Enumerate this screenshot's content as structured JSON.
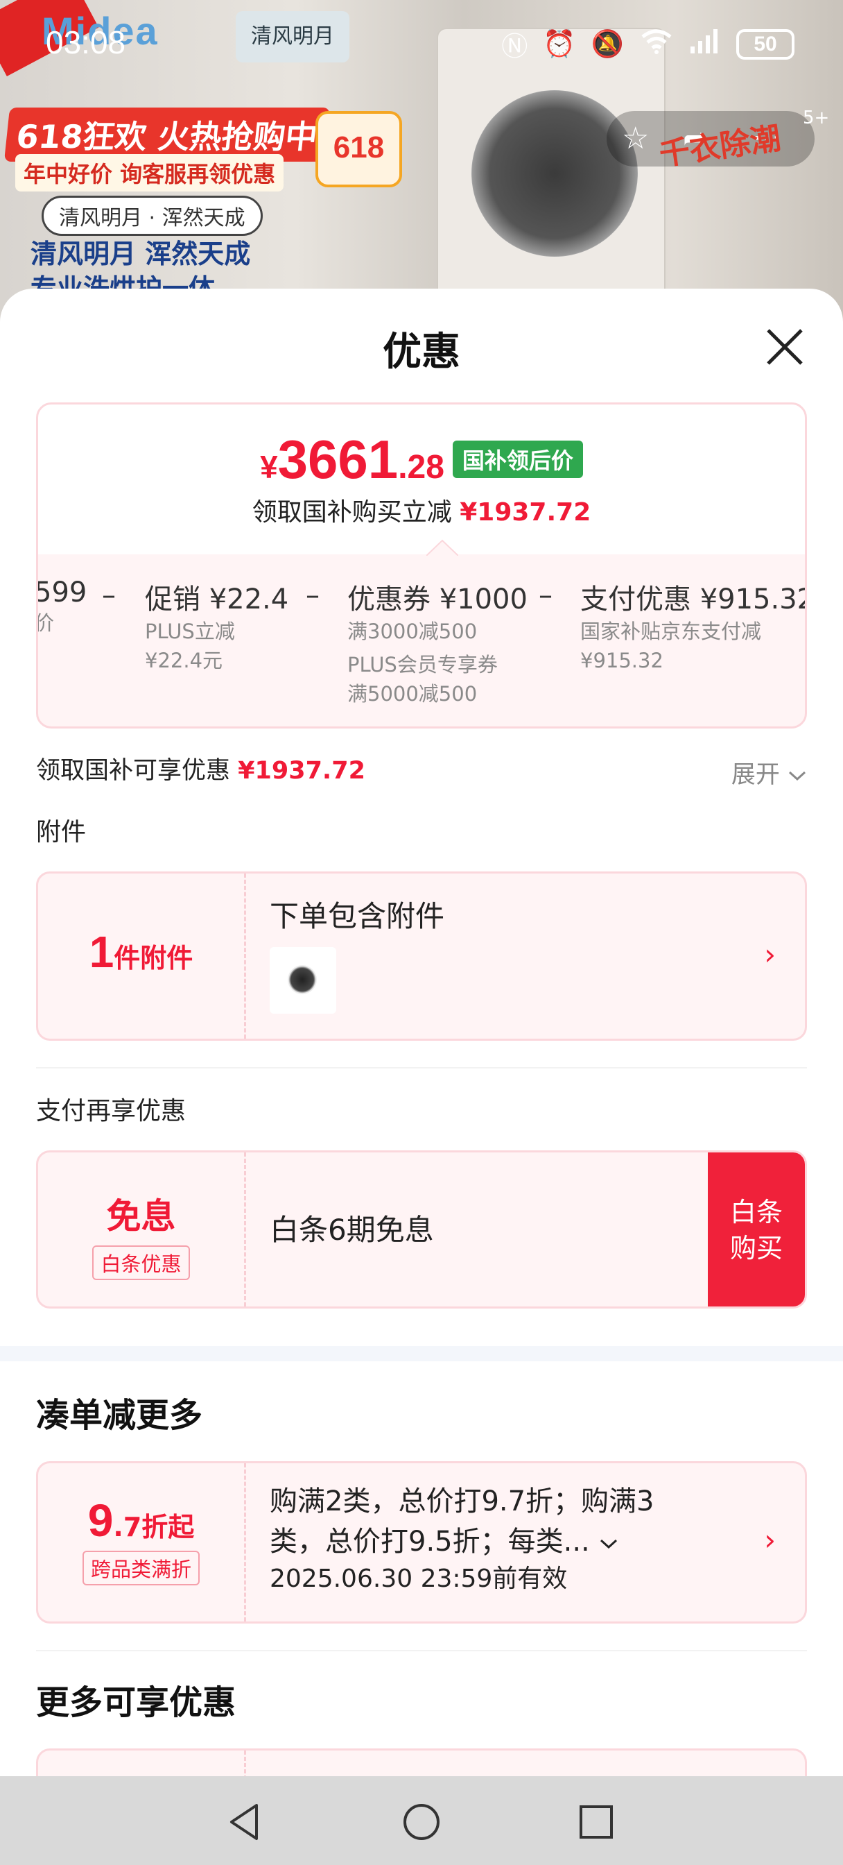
{
  "status_bar": {
    "time": "03:08",
    "battery": "50"
  },
  "background": {
    "brand": "Midea",
    "brand2": "清风明月",
    "promo_title": "618狂欢 火热抢购中",
    "promo_sub": "年中好价 询客服再领优惠",
    "pill": "清风明月 · 浑然天成",
    "slogan": "清风明月 浑然天成",
    "slogan2": "专业洗烘护一体",
    "badge_618": "618",
    "right_text": "千衣除潮",
    "share_count": "5+"
  },
  "sheet": {
    "title": "优惠"
  },
  "price_card": {
    "currency": "¥",
    "price_int": "3661",
    "price_dec": ".28",
    "price_tag": "国补领后价",
    "subtitle_prefix": "领取国补购买立减",
    "subtitle_amount": "¥1937.72",
    "breakdown": [
      {
        "title": "599",
        "desc": [
          "价"
        ]
      },
      {
        "title": "促销 ¥22.4",
        "desc": [
          "PLUS立减",
          "¥22.4元"
        ]
      },
      {
        "title": "优惠券 ¥1000",
        "desc": [
          "满3000减500",
          "PLUS会员专享券",
          "满5000减500"
        ]
      },
      {
        "title": "支付优惠 ¥915.32",
        "desc": [
          "国家补贴京东支付减",
          "¥915.32"
        ]
      }
    ],
    "minus": "–"
  },
  "saving_row": {
    "label": "领取国补可享优惠",
    "amount": "¥1937.72",
    "expand_label": "展开"
  },
  "attachments": {
    "section_label": "附件",
    "count": "1",
    "unit": "件附件",
    "title": "下单包含附件"
  },
  "payment": {
    "section_label": "支付再享优惠",
    "left_title": "免息",
    "left_tag": "白条优惠",
    "body": "白条6期免息",
    "button_line1": "白条",
    "button_line2": "购买"
  },
  "bundle": {
    "section_label": "凑单减更多",
    "big": "9",
    "small": ".7折起",
    "tag": "跨品类满折",
    "line1": "购满2类，总价打9.7折；购满3",
    "line2": "类，总价打9.5折；每类...",
    "expiry": "2025.06.30 23:59前有效"
  },
  "more": {
    "section_label": "更多可享优惠"
  },
  "colors": {
    "accent_red": "#f01a36",
    "tag_green": "#2fa84f",
    "card_bg": "#fff4f5",
    "card_border": "#fbd7dc"
  }
}
